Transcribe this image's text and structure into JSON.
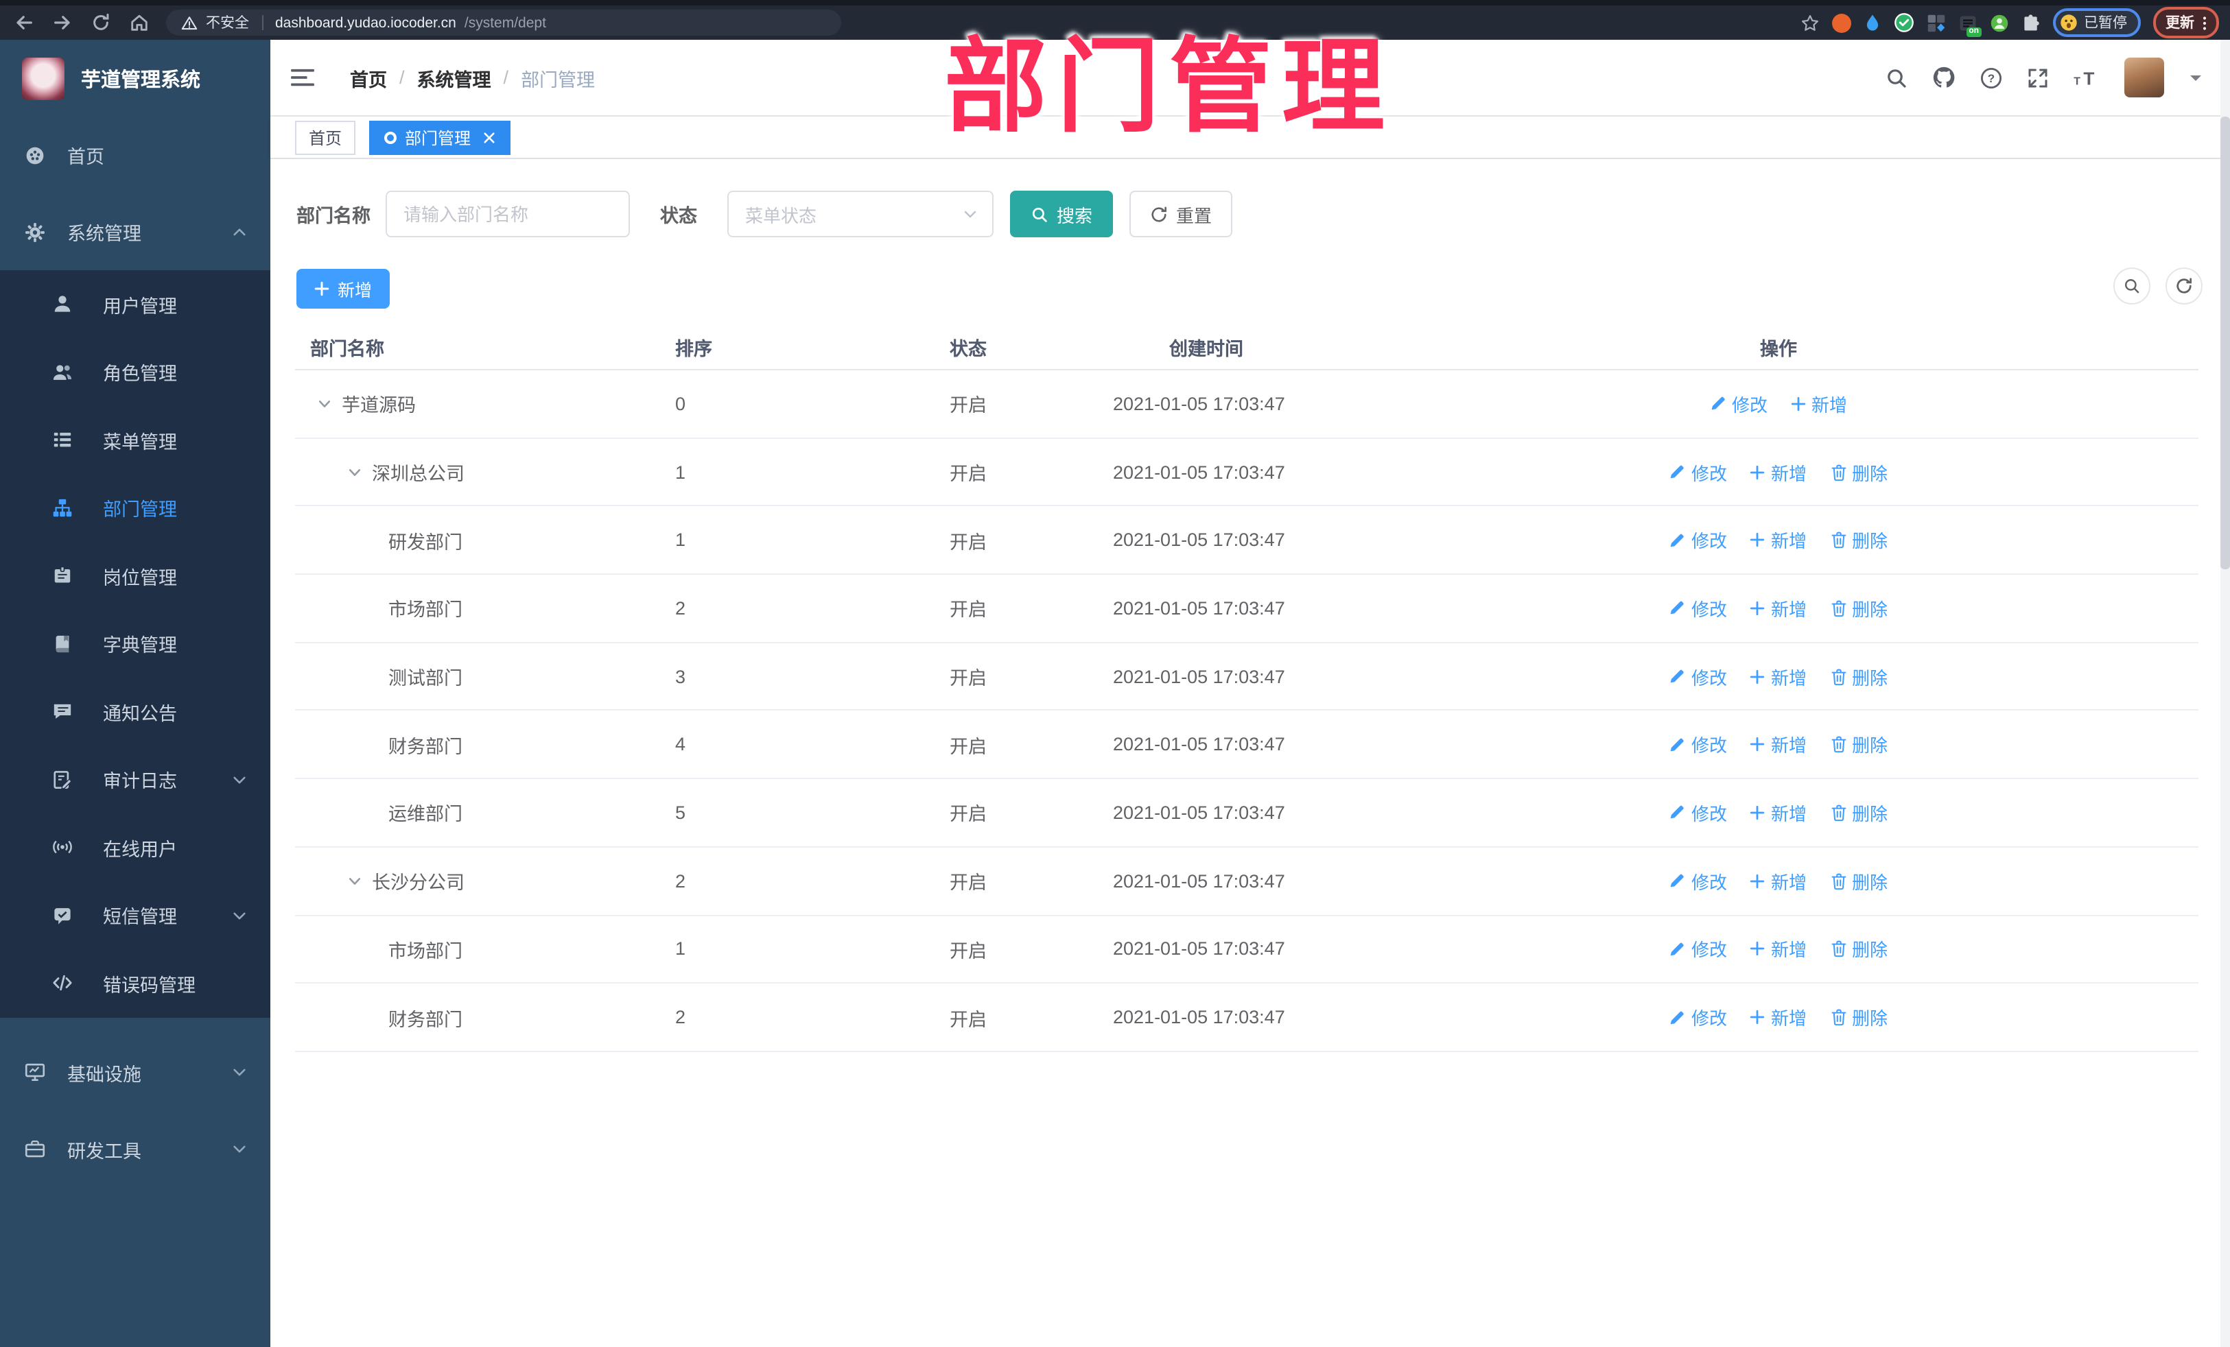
{
  "overlay_title": "部门管理",
  "browser": {
    "security_text": "不安全",
    "url_host": "dashboard.yudao.iocoder.cn",
    "url_path": "/system/dept",
    "profile_badge": "已暂停",
    "update_label": "更新",
    "ext_on_label": "on"
  },
  "sidebar": {
    "app_title": "芋道管理系统",
    "items": [
      {
        "key": "home",
        "label": "首页",
        "icon": "dashboard-icon",
        "type": "top"
      },
      {
        "key": "system-management",
        "label": "系统管理",
        "icon": "gear-icon",
        "type": "top",
        "chevron": "up",
        "opened": true
      },
      {
        "key": "user-management",
        "label": "用户管理",
        "icon": "user-icon",
        "type": "sub"
      },
      {
        "key": "role-management",
        "label": "角色管理",
        "icon": "users-icon",
        "type": "sub"
      },
      {
        "key": "menu-management",
        "label": "菜单管理",
        "icon": "menu-list-icon",
        "type": "sub"
      },
      {
        "key": "dept-management",
        "label": "部门管理",
        "icon": "org-tree-icon",
        "type": "sub",
        "active": true
      },
      {
        "key": "post-management",
        "label": "岗位管理",
        "icon": "badge-icon",
        "type": "sub"
      },
      {
        "key": "dict-management",
        "label": "字典管理",
        "icon": "book-icon",
        "type": "sub"
      },
      {
        "key": "notice-announcement",
        "label": "通知公告",
        "icon": "announcement-icon",
        "type": "sub"
      },
      {
        "key": "audit-log",
        "label": "审计日志",
        "icon": "audit-log-icon",
        "type": "sub",
        "chevron": "down"
      },
      {
        "key": "online-users",
        "label": "在线用户",
        "icon": "online-users-icon",
        "type": "sub"
      },
      {
        "key": "sms-management",
        "label": "短信管理",
        "icon": "sms-icon",
        "type": "sub",
        "chevron": "down"
      },
      {
        "key": "error-code-management",
        "label": "错误码管理",
        "icon": "error-code-icon",
        "type": "sub"
      },
      {
        "key": "infrastructure",
        "label": "基础设施",
        "icon": "infrastructure-icon",
        "type": "top",
        "chevron": "down",
        "gap": true
      },
      {
        "key": "dev-tools",
        "label": "研发工具",
        "icon": "dev-tools-icon",
        "type": "top",
        "chevron": "down"
      }
    ]
  },
  "header": {
    "breadcrumb": [
      "首页",
      "系统管理",
      "部门管理"
    ],
    "separator": "/"
  },
  "tags": {
    "home": "首页",
    "active": "部门管理"
  },
  "filter": {
    "name_label": "部门名称",
    "name_placeholder": "请输入部门名称",
    "status_label": "状态",
    "status_placeholder": "菜单状态",
    "search_label": "搜索",
    "reset_label": "重置"
  },
  "toolbar": {
    "add_label": "新增"
  },
  "table": {
    "columns": [
      "部门名称",
      "排序",
      "状态",
      "创建时间",
      "操作"
    ],
    "ops": {
      "edit": "修改",
      "add": "新增",
      "del": "删除"
    },
    "rows": [
      {
        "name": "芋道源码",
        "level": 0,
        "expandable": true,
        "sort": "0",
        "status": "开启",
        "time": "2021-01-05 17:03:47",
        "del": false
      },
      {
        "name": "深圳总公司",
        "level": 1,
        "expandable": true,
        "sort": "1",
        "status": "开启",
        "time": "2021-01-05 17:03:47",
        "del": true
      },
      {
        "name": "研发部门",
        "level": 2,
        "expandable": false,
        "sort": "1",
        "status": "开启",
        "time": "2021-01-05 17:03:47",
        "del": true
      },
      {
        "name": "市场部门",
        "level": 2,
        "expandable": false,
        "sort": "2",
        "status": "开启",
        "time": "2021-01-05 17:03:47",
        "del": true
      },
      {
        "name": "测试部门",
        "level": 2,
        "expandable": false,
        "sort": "3",
        "status": "开启",
        "time": "2021-01-05 17:03:47",
        "del": true
      },
      {
        "name": "财务部门",
        "level": 2,
        "expandable": false,
        "sort": "4",
        "status": "开启",
        "time": "2021-01-05 17:03:47",
        "del": true
      },
      {
        "name": "运维部门",
        "level": 2,
        "expandable": false,
        "sort": "5",
        "status": "开启",
        "time": "2021-01-05 17:03:47",
        "del": true
      },
      {
        "name": "长沙分公司",
        "level": 1,
        "expandable": true,
        "sort": "2",
        "status": "开启",
        "time": "2021-01-05 17:03:47",
        "del": true
      },
      {
        "name": "市场部门",
        "level": 2,
        "expandable": false,
        "sort": "1",
        "status": "开启",
        "time": "2021-01-05 17:03:47",
        "del": true
      },
      {
        "name": "财务部门",
        "level": 2,
        "expandable": false,
        "sort": "2",
        "status": "开启",
        "time": "2021-01-05 17:03:47",
        "del": true
      }
    ]
  }
}
